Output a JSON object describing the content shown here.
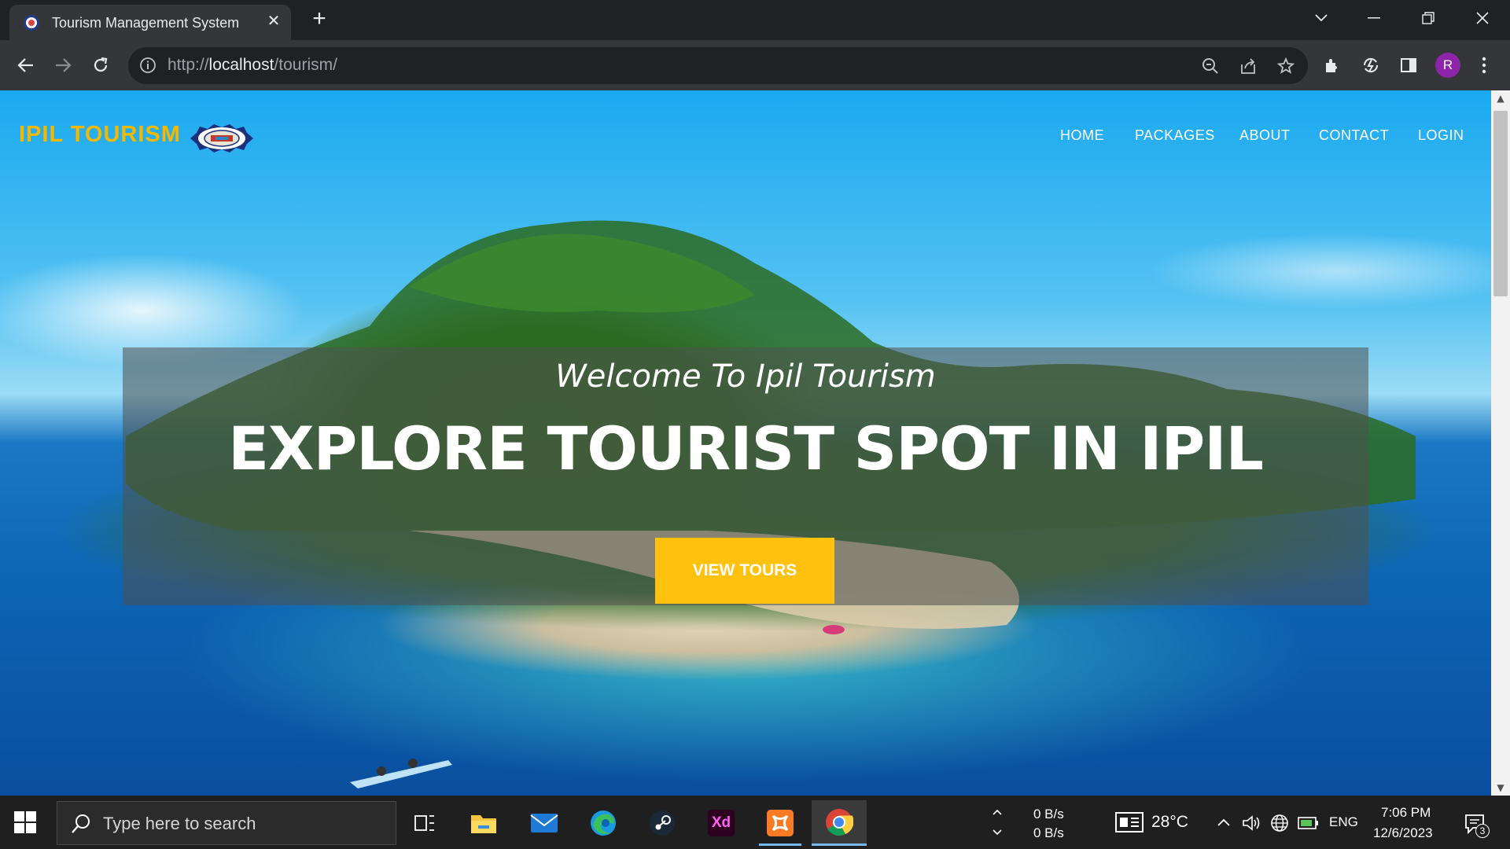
{
  "browser": {
    "tab_title": "Tourism Management System",
    "tab_close": "✕",
    "new_tab": "+",
    "url_scheme": "http://",
    "url_host": "localhost",
    "url_path": "/tourism/",
    "profile_initial": "R"
  },
  "site": {
    "logo_text": "IPIL TOURISM",
    "nav": [
      "HOME",
      "PACKAGES",
      "ABOUT",
      "CONTACT",
      "LOGIN"
    ],
    "hero": {
      "welcome": "Welcome To Ipil Tourism",
      "title": "EXPLORE TOURIST SPOT IN IPIL",
      "button": "VIEW TOURS"
    },
    "colors": {
      "accent": "#fec10e",
      "logo": "#f5b800"
    }
  },
  "taskbar": {
    "search_placeholder": "Type here to search",
    "apps": [
      "task-view",
      "file-explorer",
      "mail",
      "edge",
      "steam",
      "adobe-xd",
      "xampp",
      "chrome"
    ],
    "xd_label": "Xd",
    "net_up": "0 B/s",
    "net_down": "0 B/s",
    "temperature": "28°C",
    "language": "ENG",
    "time": "7:06 PM",
    "date": "12/6/2023",
    "notification_count": "3"
  }
}
